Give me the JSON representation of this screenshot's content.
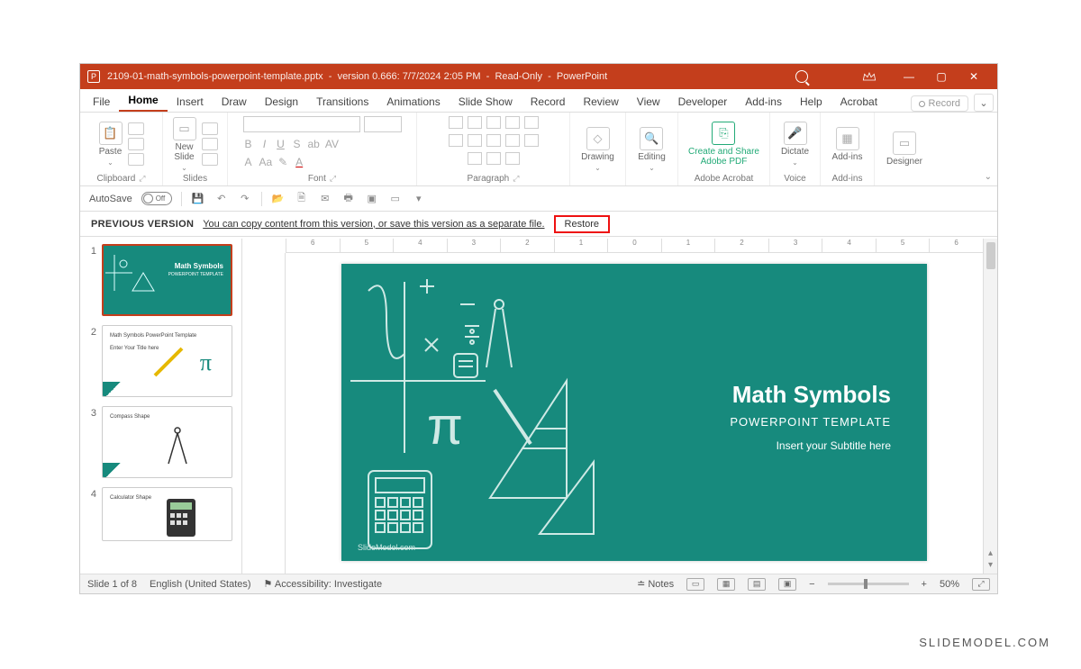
{
  "titlebar": {
    "filename": "2109-01-math-symbols-powerpoint-template.pptx",
    "version_info": "version 0.666: 7/7/2024 2:05 PM",
    "mode": "Read-Only",
    "app": "PowerPoint"
  },
  "tabs": {
    "items": [
      "File",
      "Home",
      "Insert",
      "Draw",
      "Design",
      "Transitions",
      "Animations",
      "Slide Show",
      "Record",
      "Review",
      "View",
      "Developer",
      "Add-ins",
      "Help",
      "Acrobat"
    ],
    "active": "Home",
    "record_button": "Record"
  },
  "ribbon": {
    "clipboard": {
      "label": "Clipboard",
      "paste": "Paste"
    },
    "slides": {
      "label": "Slides",
      "new_slide": "New\nSlide"
    },
    "font": {
      "label": "Font"
    },
    "paragraph": {
      "label": "Paragraph"
    },
    "drawing": {
      "label": "Drawing"
    },
    "editing": {
      "label": "Editing"
    },
    "acrobat": {
      "label": "Adobe Acrobat",
      "btn": "Create and Share\nAdobe PDF"
    },
    "voice": {
      "label": "Voice",
      "btn": "Dictate"
    },
    "addins": {
      "label": "Add-ins",
      "btn": "Add-ins"
    },
    "designer": {
      "label": "",
      "btn": "Designer"
    }
  },
  "qat": {
    "autosave": "AutoSave",
    "autosave_state": "Off"
  },
  "version_bar": {
    "label": "PREVIOUS VERSION",
    "message": "You can copy content from this version, or save this version as a separate file.",
    "restore": "Restore"
  },
  "thumbnails": [
    {
      "num": "1",
      "title": "Math Symbols",
      "sub": "POWERPOINT TEMPLATE"
    },
    {
      "num": "2",
      "title": "Math Symbols PowerPoint Template",
      "sub": "Enter Your Title here"
    },
    {
      "num": "3",
      "title": "Compass Shape",
      "sub": ""
    },
    {
      "num": "4",
      "title": "Calculator Shape",
      "sub": ""
    }
  ],
  "slide": {
    "title": "Math Symbols",
    "subtitle": "POWERPOINT TEMPLATE",
    "subtext": "Insert your Subtitle here",
    "footer": "SlideModel.com"
  },
  "ruler": {
    "labels": [
      "6",
      "5",
      "4",
      "3",
      "2",
      "1",
      "0",
      "1",
      "2",
      "3",
      "4",
      "5",
      "6"
    ]
  },
  "status": {
    "slide_of": "Slide 1 of 8",
    "language": "English (United States)",
    "accessibility": "Accessibility: Investigate",
    "notes": "Notes",
    "zoom": "50%"
  },
  "watermark": "SLIDEMODEL.COM"
}
